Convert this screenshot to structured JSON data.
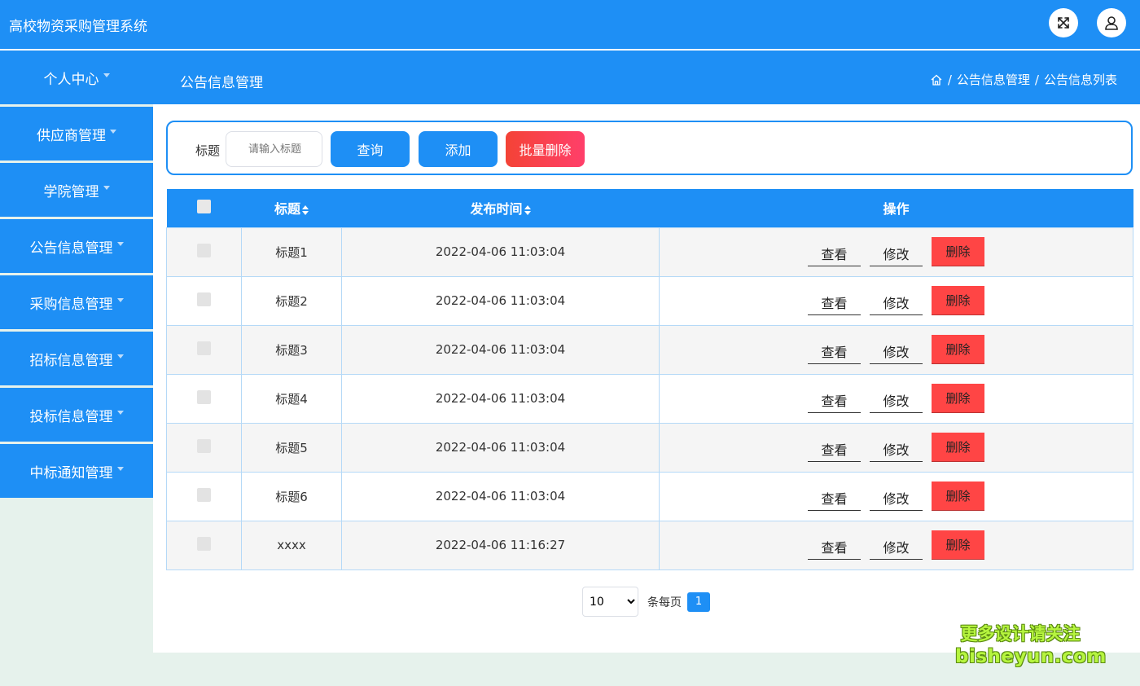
{
  "app": {
    "title": "高校物资采购管理系统"
  },
  "header_icons": {
    "fullscreen": "expand-icon",
    "user": "user-icon"
  },
  "sidebar": {
    "items": [
      {
        "label": "个人中心"
      },
      {
        "label": "供应商管理"
      },
      {
        "label": "学院管理"
      },
      {
        "label": "公告信息管理"
      },
      {
        "label": "采购信息管理"
      },
      {
        "label": "招标信息管理"
      },
      {
        "label": "投标信息管理"
      },
      {
        "label": "中标通知管理"
      }
    ]
  },
  "subheader": {
    "title": "公告信息管理",
    "breadcrumb": {
      "sep1": "/",
      "level1": "公告信息管理",
      "sep2": "/",
      "level2": "公告信息列表"
    }
  },
  "search": {
    "label": "标题",
    "placeholder": "请输入标题",
    "query_label": "查询",
    "add_label": "添加",
    "batch_delete_label": "批量删除"
  },
  "table": {
    "headers": {
      "title": "标题",
      "publish_time": "发布时间",
      "actions": "操作"
    },
    "rows": [
      {
        "title": "标题1",
        "time": "2022-04-06 11:03:04"
      },
      {
        "title": "标题2",
        "time": "2022-04-06 11:03:04"
      },
      {
        "title": "标题3",
        "time": "2022-04-06 11:03:04"
      },
      {
        "title": "标题4",
        "time": "2022-04-06 11:03:04"
      },
      {
        "title": "标题5",
        "time": "2022-04-06 11:03:04"
      },
      {
        "title": "标题6",
        "time": "2022-04-06 11:03:04"
      },
      {
        "title": "xxxx",
        "time": "2022-04-06 11:16:27"
      }
    ],
    "row_actions": {
      "view": "查看",
      "edit": "修改",
      "delete": "删除"
    }
  },
  "pagination": {
    "page_size": "10",
    "unit": "条每页",
    "current_page": "1"
  },
  "watermark": {
    "line1": "更多设计请关注",
    "line2": "bisheyun.com"
  },
  "colors": {
    "primary": "#1e8ff5",
    "danger": "#ff4545",
    "background": "#e6f2ec"
  }
}
